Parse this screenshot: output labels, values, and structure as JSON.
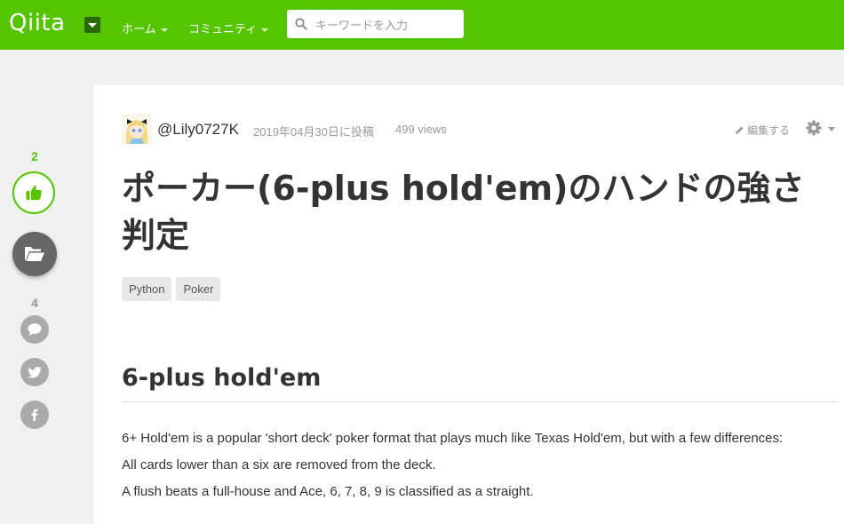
{
  "header": {
    "logo": "Qiita",
    "nav": [
      {
        "label": "ホーム"
      },
      {
        "label": "コミュニティ"
      }
    ],
    "search": {
      "placeholder": "キーワードを入力",
      "value": ""
    }
  },
  "side": {
    "like_count": "2",
    "comment_count": "4"
  },
  "article": {
    "author": "@Lily0727K",
    "date": "2019年04月30日に投稿",
    "views": "499 views",
    "edit_label": "編集する",
    "title": "ポーカー(6-plus hold'em)のハンドの強さ判定",
    "tags": [
      "Python",
      "Poker"
    ],
    "section_heading": "6-plus hold'em",
    "paragraphs": [
      "6+ Hold'em is a popular 'short deck' poker format that plays much like Texas Hold'em, but with a few differences:",
      "All cards lower than a six are removed from the deck.",
      "A flush beats a full-house and Ace, 6, 7, 8, 9 is classified as a straight."
    ]
  },
  "colors": {
    "brand": "#55c500",
    "stock_button": "#666666",
    "icon_button": "#aaaaaa"
  },
  "icons": [
    "search-icon",
    "thumbs-up-icon",
    "folder-open-icon",
    "comment-icon",
    "twitter-icon",
    "facebook-icon",
    "pencil-icon",
    "gear-icon"
  ]
}
